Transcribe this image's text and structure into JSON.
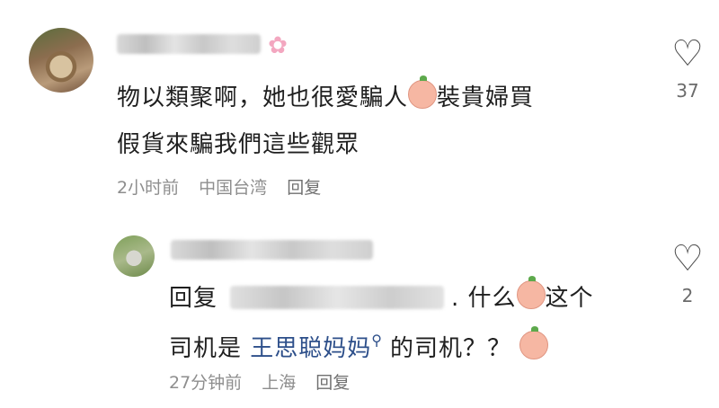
{
  "comments": [
    {
      "lines": [
        "物以類聚啊，她也很愛騙人",
        "裝貴婦買",
        "假貨來騙我們這些觀眾"
      ],
      "time": "2小时前",
      "location": "中国台湾",
      "reply_label": "回复",
      "likes": "37"
    }
  ],
  "reply": {
    "prefix": "回复",
    "after_mention": ". 什么",
    "after_emoji": "这个",
    "line2_before": "司机是",
    "mention_link": "王思聪妈妈",
    "line2_after": "的司机？？",
    "time": "27分钟前",
    "location": "上海",
    "reply_label": "回复",
    "likes": "2"
  },
  "icons": {
    "heart": "heart-outline-icon",
    "blossom": "cherry-blossom-icon",
    "peach": "peach-emoji-icon",
    "search": "search-icon"
  }
}
